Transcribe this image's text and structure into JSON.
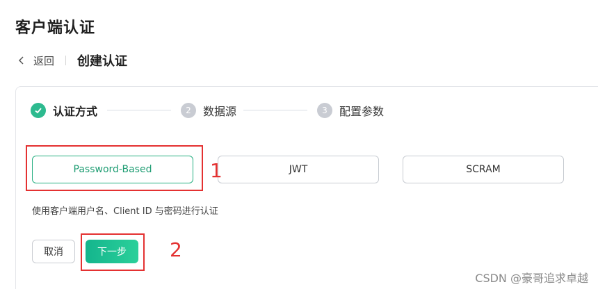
{
  "page": {
    "title": "客户端认证"
  },
  "nav": {
    "back_label": "返回",
    "subtitle": "创建认证"
  },
  "steps": [
    {
      "index": "1",
      "label": "认证方式",
      "status": "done"
    },
    {
      "index": "2",
      "label": "数据源",
      "status": "todo"
    },
    {
      "index": "3",
      "label": "配置参数",
      "status": "todo"
    }
  ],
  "methods": [
    {
      "label": "Password-Based",
      "selected": true
    },
    {
      "label": "JWT",
      "selected": false
    },
    {
      "label": "SCRAM",
      "selected": false
    }
  ],
  "description": "使用客户端用户名、Client ID 与密码进行认证",
  "actions": {
    "cancel_label": "取消",
    "next_label": "下一步"
  },
  "annotations": {
    "first": "1",
    "second": "2"
  },
  "watermark": "CSDN @豪哥追求卓越",
  "colors": {
    "accent": "#23ae7f",
    "annotation": "#e43131",
    "step_todo": "#c9ccd3"
  },
  "icons": {
    "back": "chevron-left-icon",
    "step_done": "check-icon"
  }
}
